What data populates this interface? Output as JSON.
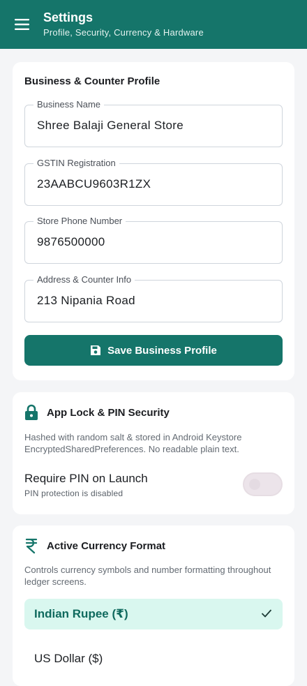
{
  "header": {
    "title": "Settings",
    "subtitle": "Profile, Security, Currency & Hardware",
    "menu_icon": "hamburger-menu-icon"
  },
  "business_profile": {
    "title": "Business & Counter Profile",
    "fields": [
      {
        "label": "Business Name",
        "value": "Shree Balaji General Store"
      },
      {
        "label": "GSTIN Registration",
        "value": "23AABCU9603R1ZX"
      },
      {
        "label": "Store Phone Number",
        "value": "9876500000"
      },
      {
        "label": "Address & Counter Info",
        "value": "213 Nipania Road"
      }
    ],
    "save_label": "Save Business Profile",
    "save_icon": "floppy-disk-icon"
  },
  "security": {
    "title": "App Lock & PIN Security",
    "icon": "lock-icon",
    "description": "Hashed with random salt & stored in Android Keystore EncryptedSharedPreferences. No readable plain text.",
    "toggle_label": "Require PIN on Launch",
    "toggle_status": "PIN protection is disabled",
    "toggle_on": false
  },
  "currency": {
    "title": "Active Currency Format",
    "icon": "rupee-icon",
    "description": "Controls currency symbols and number formatting throughout ledger screens.",
    "options": [
      {
        "label": "Indian Rupee (₹)",
        "selected": true
      },
      {
        "label": "US Dollar ($)",
        "selected": false
      }
    ]
  },
  "colors": {
    "primary": "#15756A",
    "selected_bg": "#D9F7EF",
    "background": "#F4F5F7"
  }
}
